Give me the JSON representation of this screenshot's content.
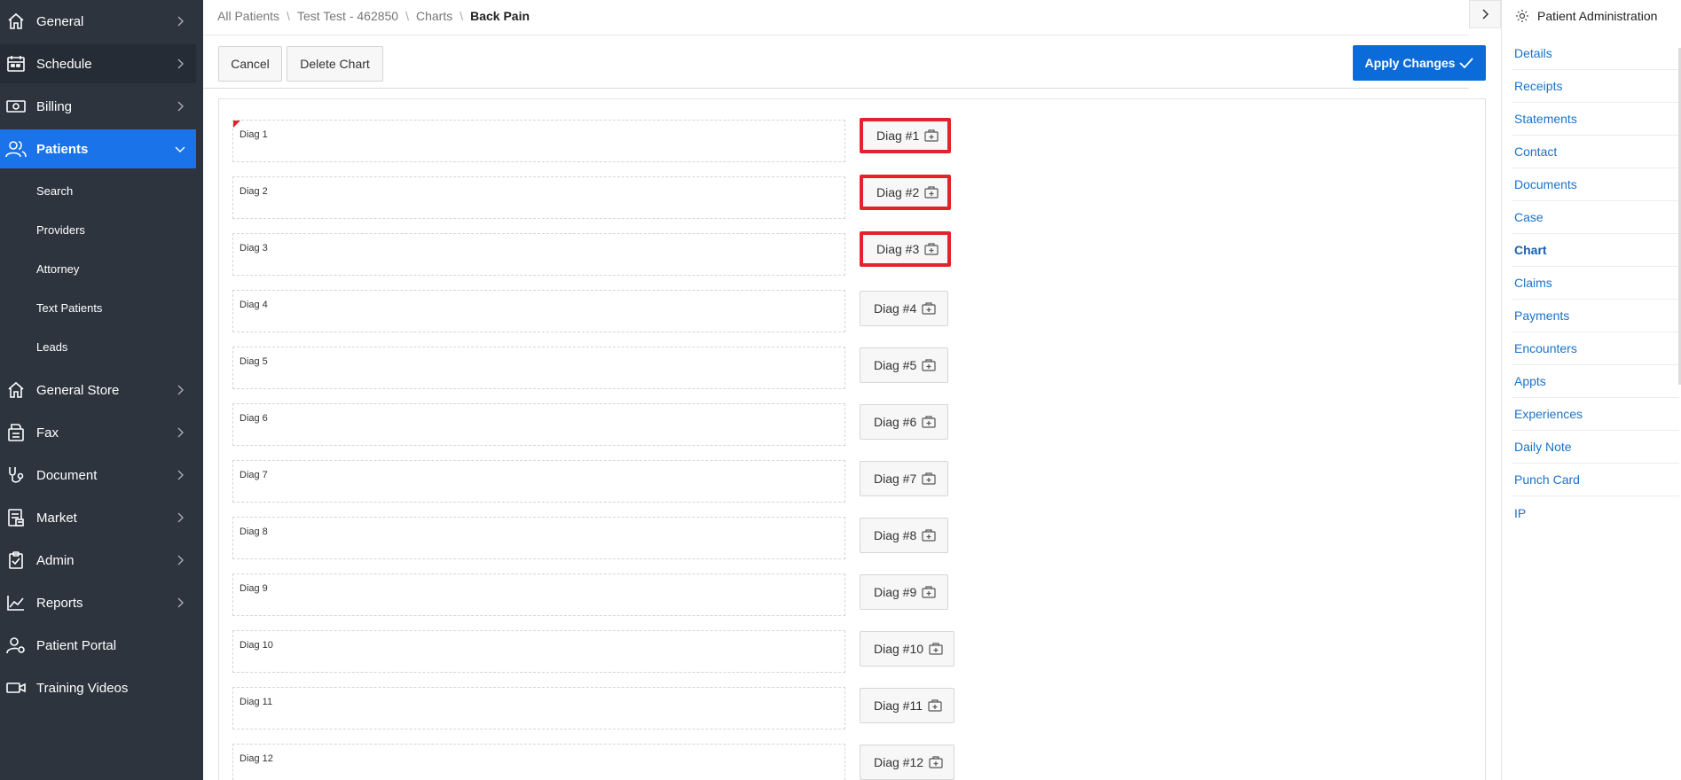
{
  "sidebar": {
    "items": [
      {
        "label": "General",
        "icon": "home-icon"
      },
      {
        "label": "Schedule",
        "icon": "calendar-icon"
      },
      {
        "label": "Billing",
        "icon": "money-icon"
      },
      {
        "label": "Patients",
        "icon": "users-icon"
      },
      {
        "label": "General Store",
        "icon": "home-icon"
      },
      {
        "label": "Fax",
        "icon": "fax-icon"
      },
      {
        "label": "Document",
        "icon": "stethoscope-icon"
      },
      {
        "label": "Market",
        "icon": "market-icon"
      },
      {
        "label": "Admin",
        "icon": "clipboard-icon"
      },
      {
        "label": "Reports",
        "icon": "chart-line-icon"
      },
      {
        "label": "Patient Portal",
        "icon": "user-gear-icon"
      },
      {
        "label": "Training Videos",
        "icon": "video-icon"
      }
    ],
    "patients_sub": [
      "Search",
      "Providers",
      "Attorney",
      "Text Patients",
      "Leads"
    ]
  },
  "breadcrumb": {
    "items": [
      "All Patients",
      "Test Test - 462850",
      "Charts"
    ],
    "current": "Back Pain"
  },
  "toolbar": {
    "cancel_label": "Cancel",
    "delete_label": "Delete Chart",
    "apply_label": "Apply Changes"
  },
  "diagnoses": [
    {
      "label": "Diag 1",
      "button": "Diag #1"
    },
    {
      "label": "Diag 2",
      "button": "Diag #2"
    },
    {
      "label": "Diag 3",
      "button": "Diag #3"
    },
    {
      "label": "Diag 4",
      "button": "Diag #4"
    },
    {
      "label": "Diag 5",
      "button": "Diag #5"
    },
    {
      "label": "Diag 6",
      "button": "Diag #6"
    },
    {
      "label": "Diag 7",
      "button": "Diag #7"
    },
    {
      "label": "Diag 8",
      "button": "Diag #8"
    },
    {
      "label": "Diag 9",
      "button": "Diag #9"
    },
    {
      "label": "Diag 10",
      "button": "Diag #10"
    },
    {
      "label": "Diag 11",
      "button": "Diag #11"
    },
    {
      "label": "Diag 12",
      "button": "Diag #12"
    }
  ],
  "right_panel": {
    "title": "Patient Administration",
    "links": [
      "Details",
      "Receipts",
      "Statements",
      "Contact",
      "Documents",
      "Case",
      "Chart",
      "Claims",
      "Payments",
      "Encounters",
      "Appts",
      "Experiences",
      "Daily Note",
      "Punch Card",
      "IP"
    ],
    "active": "Chart"
  },
  "colors": {
    "sidebar_bg": "#2d343e",
    "active_blue": "#1a73e8",
    "primary_button": "#0b6bd8",
    "highlight_red": "#e3232b",
    "link_blue": "#1a73c8"
  }
}
